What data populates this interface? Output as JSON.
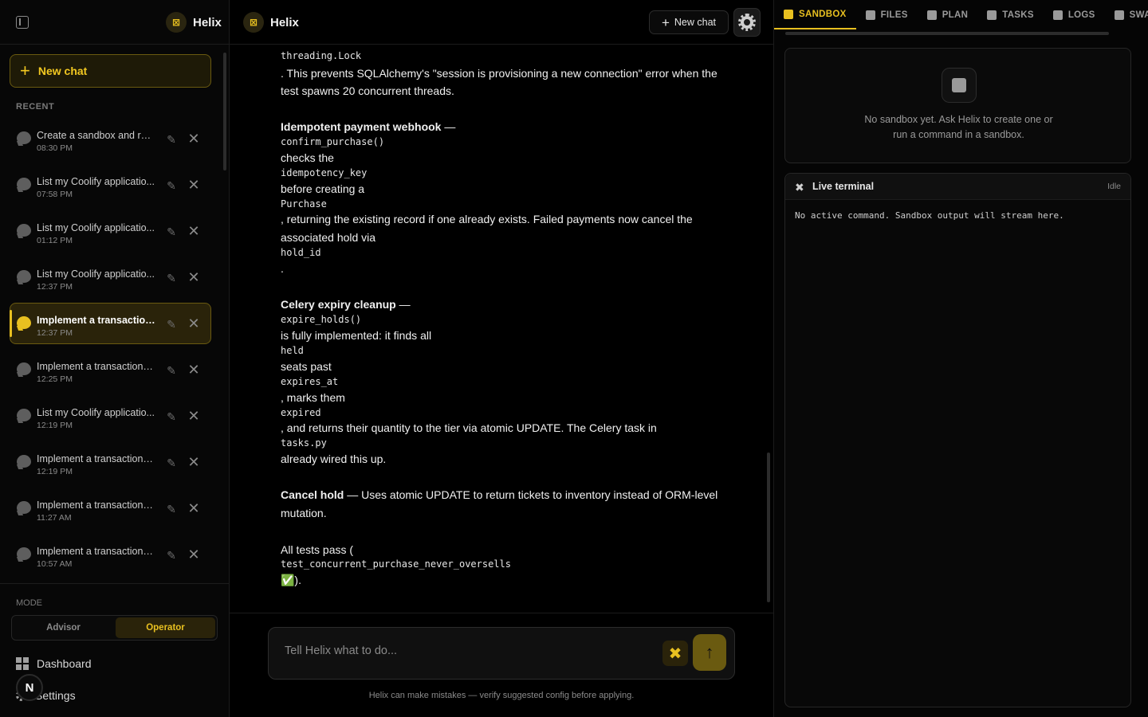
{
  "app": {
    "name": "Helix",
    "logo_glyph": "⊠"
  },
  "sidebar": {
    "new_chat_label": "New chat",
    "recent_label": "RECENT",
    "chats": [
      {
        "title": "Create a sandbox and run...",
        "time": "08:30 PM",
        "active": false
      },
      {
        "title": "List my Coolify applicatio...",
        "time": "07:58 PM",
        "active": false
      },
      {
        "title": "List my Coolify applicatio...",
        "time": "01:12 PM",
        "active": false
      },
      {
        "title": "List my Coolify applicatio...",
        "time": "12:37 PM",
        "active": false
      },
      {
        "title": "Implement a transaction...",
        "time": "12:37 PM",
        "active": true
      },
      {
        "title": "Implement a transactiona...",
        "time": "12:25 PM",
        "active": false
      },
      {
        "title": "List my Coolify applicatio...",
        "time": "12:19 PM",
        "active": false
      },
      {
        "title": "Implement a transactiona...",
        "time": "12:19 PM",
        "active": false
      },
      {
        "title": "Implement a transactiona...",
        "time": "11:27 AM",
        "active": false
      },
      {
        "title": "Implement a transactiona...",
        "time": "10:57 AM",
        "active": false
      }
    ],
    "mode_label": "MODE",
    "mode_options": {
      "advisor": "Advisor",
      "operator": "Operator"
    },
    "mode_selected": "Operator",
    "dashboard_label": "Dashboard",
    "settings_label": "Settings",
    "avatar_initial": "N"
  },
  "header": {
    "new_chat_label": "New chat"
  },
  "messages": {
    "lines": [
      {
        "kind": "code",
        "text": "threading.Lock"
      },
      {
        "kind": "text",
        "text": ". This prevents SQLAlchemy's \"session is provisioning a new connection\" error when the"
      },
      {
        "kind": "text",
        "text": "test spawns 20 concurrent threads."
      },
      {
        "kind": "heading",
        "bold": "Idempotent payment webhook",
        "text": " —"
      },
      {
        "kind": "code",
        "text": "confirm_purchase()"
      },
      {
        "kind": "text",
        "text": " checks the"
      },
      {
        "kind": "code",
        "text": "idempotency_key"
      },
      {
        "kind": "text",
        "text": " before creating a"
      },
      {
        "kind": "code",
        "text": "Purchase"
      },
      {
        "kind": "text",
        "text": ", returning the existing record if one already exists. Failed payments now cancel the"
      },
      {
        "kind": "text",
        "text": "associated hold via"
      },
      {
        "kind": "code",
        "text": "hold_id"
      },
      {
        "kind": "text",
        "text": "."
      },
      {
        "kind": "heading",
        "bold": "Celery expiry cleanup",
        "text": " —"
      },
      {
        "kind": "code",
        "text": "expire_holds()"
      },
      {
        "kind": "text",
        "text": " is fully implemented: it finds all"
      },
      {
        "kind": "code",
        "text": "held"
      },
      {
        "kind": "text",
        "text": " seats past"
      },
      {
        "kind": "code",
        "text": "expires_at"
      },
      {
        "kind": "text",
        "text": ", marks them"
      },
      {
        "kind": "code",
        "text": "expired"
      },
      {
        "kind": "text",
        "text": ", and returns their quantity to the tier via atomic UPDATE. The Celery task in"
      },
      {
        "kind": "code",
        "text": "tasks.py"
      },
      {
        "kind": "text",
        "text": " already wired this up."
      },
      {
        "kind": "heading",
        "bold": "Cancel hold",
        "text": " — Uses atomic UPDATE to return tickets to inventory instead of ORM-level"
      },
      {
        "kind": "text",
        "text": "mutation."
      },
      {
        "kind": "text",
        "text": "All tests pass ("
      },
      {
        "kind": "code",
        "text": "test_concurrent_purchase_never_oversells"
      },
      {
        "kind": "text",
        "text": " ✅)."
      }
    ]
  },
  "composer": {
    "placeholder": "Tell Helix what to do...",
    "disclaimer": "Helix can make mistakes — verify suggested config before applying."
  },
  "right_panel": {
    "tabs": [
      {
        "label": "SANDBOX",
        "icon": "sandbox-icon",
        "active": true
      },
      {
        "label": "FILES",
        "icon": "file-icon",
        "active": false
      },
      {
        "label": "PLAN",
        "icon": "plan-icon",
        "active": false
      },
      {
        "label": "TASKS",
        "icon": "tasks-icon",
        "active": false
      },
      {
        "label": "LOGS",
        "icon": "logs-icon",
        "active": false
      },
      {
        "label": "SWA",
        "icon": "swarm-icon",
        "active": false
      }
    ],
    "sandbox_empty": "No sandbox yet. Ask Helix to create one or run a command in a sandbox.",
    "terminal": {
      "title": "Live terminal",
      "status": "Idle",
      "output": "No active command. Sandbox output will stream here."
    }
  },
  "colors": {
    "accent": "#e8c020",
    "background": "#000000",
    "panel": "#0a0a0a"
  }
}
